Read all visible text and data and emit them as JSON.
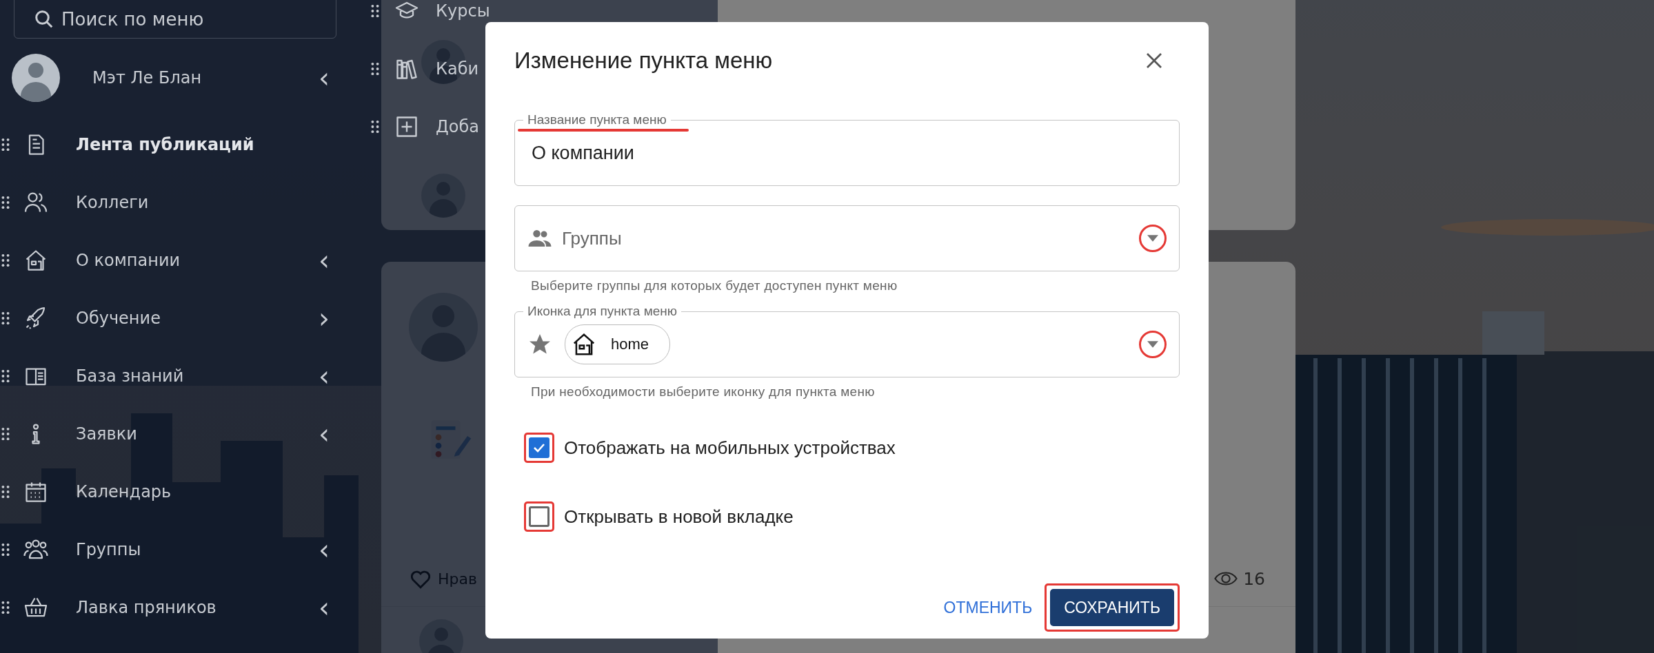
{
  "sidebar": {
    "search": {
      "placeholder": "Поиск по меню"
    },
    "user": {
      "name": "Мэт Ле Блан",
      "chevron": "‹"
    },
    "items": [
      {
        "label": "Лента публикаций",
        "selected": true
      },
      {
        "label": "Коллеги",
        "selected": false
      },
      {
        "label": "О компании",
        "selected": false,
        "chevron": "‹"
      },
      {
        "label": "Обучение",
        "selected": false,
        "chevron": "›"
      },
      {
        "label": "База знаний",
        "selected": false,
        "chevron": "‹"
      },
      {
        "label": "Заявки",
        "selected": false,
        "chevron": "‹"
      },
      {
        "label": "Календарь",
        "selected": false
      },
      {
        "label": "Группы",
        "selected": false,
        "chevron": "‹"
      },
      {
        "label": "Лавка пряников",
        "selected": false,
        "chevron": "‹"
      }
    ]
  },
  "submenu": {
    "items": [
      {
        "label": "Курсы",
        "kind": "course"
      },
      {
        "label": "Каби",
        "kind": "library"
      },
      {
        "label": "Доба",
        "kind": "add"
      }
    ]
  },
  "feed": {
    "like_label": "Нрав",
    "views": "16"
  },
  "dialog": {
    "title": "Изменение пункта меню",
    "name_field": {
      "label": "Название пункта меню",
      "value": "О компании"
    },
    "groups_field": {
      "placeholder": "Группы",
      "hint": "Выберите группы для которых будет доступен пункт меню"
    },
    "icon_field": {
      "label": "Иконка для пункта меню",
      "chip": "home",
      "hint": "При необходимости выберите иконку для пункта меню"
    },
    "checkboxes": [
      {
        "label": "Отображать на мобильных устройствах",
        "checked": true
      },
      {
        "label": "Открывать в новой вкладке",
        "checked": false
      }
    ],
    "buttons": [
      {
        "label": "ОТМЕНИТЬ",
        "kind": "text"
      },
      {
        "label": "СОХРАНИТЬ",
        "kind": "primary"
      }
    ]
  }
}
